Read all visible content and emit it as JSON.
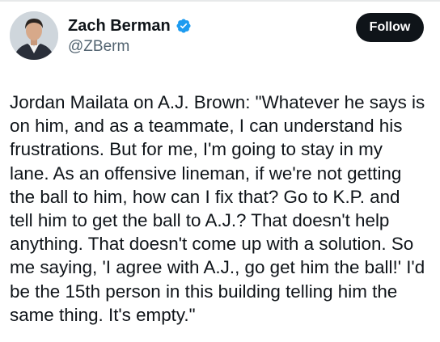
{
  "author": {
    "display_name": "Zach Berman",
    "handle": "@ZBerm",
    "verified": true,
    "verified_icon": "verified-badge-icon",
    "avatar_icon": "profile-photo"
  },
  "actions": {
    "follow_label": "Follow"
  },
  "tweet": {
    "lines": [
      "Jordan Mailata on A.J. Brown: \"Whatever he says is",
      "on him, and as a teammate, I can understand his",
      "frustrations. But for me, I'm going to stay in my",
      "lane. As an offensive lineman, if we're not getting",
      "the ball to him, how can I fix that? Go to K.P. and",
      "tell him to get the ball to A.J.? That doesn't help",
      "anything. That doesn't come up with a solution. So",
      "me saying, 'I agree with A.J., go get him the ball!' I'd",
      "be the 15th person in this building telling him the",
      "same thing. It's empty.\""
    ]
  },
  "colors": {
    "text": "#0f1419",
    "secondary": "#536471",
    "verified": "#1d9bf0",
    "button_bg": "#0f1419"
  }
}
